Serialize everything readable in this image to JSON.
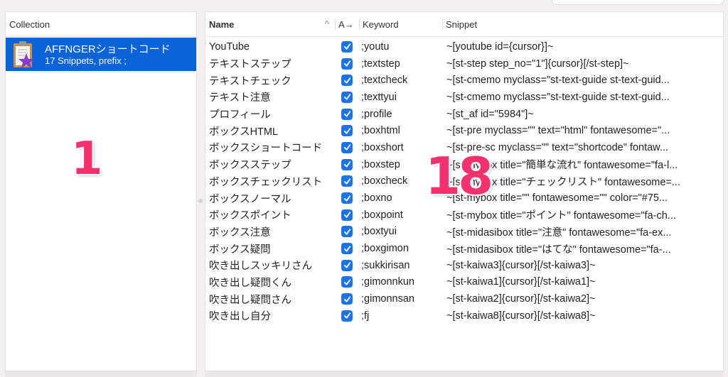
{
  "collection_pane": {
    "header": "Collection",
    "selected_item": {
      "title": "AFFNGERショートコード",
      "subtitle": "17 Snippets, prefix ;",
      "icon": "clipboard-star-icon"
    }
  },
  "snippets_pane": {
    "columns": {
      "name": "Name",
      "sort_indicator": "^",
      "auto_expand": "A→",
      "keyword": "Keyword",
      "snippet": "Snippet"
    },
    "rows": [
      {
        "name": "YouTube",
        "enabled": true,
        "keyword": ";youtu",
        "snippet": "~[youtube id={cursor}]~"
      },
      {
        "name": "テキストステップ",
        "enabled": true,
        "keyword": ";textstep",
        "snippet": "~[st-step step_no=\"1\"]{cursor}[/st-step]~"
      },
      {
        "name": "テキストチェック",
        "enabled": true,
        "keyword": ";textcheck",
        "snippet": "~[st-cmemo myclass=\"st-text-guide st-text-guid..."
      },
      {
        "name": "テキスト注意",
        "enabled": true,
        "keyword": ";texttyui",
        "snippet": "~[st-cmemo myclass=\"st-text-guide st-text-guid..."
      },
      {
        "name": "プロフィール",
        "enabled": true,
        "keyword": ";profile",
        "snippet": "~[st_af id=\"5984\"]~"
      },
      {
        "name": "ボックスHTML",
        "enabled": true,
        "keyword": ";boxhtml",
        "snippet": "~[st-pre myclass=\"\" text=\"html\" fontawesome=\"..."
      },
      {
        "name": "ボックスショートコード",
        "enabled": true,
        "keyword": ";boxshort",
        "snippet": "~[st-pre-sc myclass=\"\" text=\"shortcode\" fontaw..."
      },
      {
        "name": "ボックスステップ",
        "enabled": true,
        "keyword": ";boxstep",
        "snippet": "~[st-mybox title=\"簡単な流れ\" fontawesome=\"fa-l..."
      },
      {
        "name": "ボックスチェックリスト",
        "enabled": true,
        "keyword": ";boxcheck",
        "snippet": "~[st-mybox title=\"チェックリスト\" fontawesome=..."
      },
      {
        "name": "ボックスノーマル",
        "enabled": true,
        "keyword": ";boxno",
        "snippet": "~[st-mybox title=\"\" fontawesome=\"\" color=\"#75..."
      },
      {
        "name": "ボックスポイント",
        "enabled": true,
        "keyword": ";boxpoint",
        "snippet": "~[st-mybox title=\"ポイント\" fontawesome=\"fa-ch..."
      },
      {
        "name": "ボックス注意",
        "enabled": true,
        "keyword": ";boxtyui",
        "snippet": "~[st-midasibox title=\"注意\" fontawesome=\"fa-ex..."
      },
      {
        "name": "ボックス疑問",
        "enabled": true,
        "keyword": ";boxgimon",
        "snippet": "~[st-midasibox title=\"はてな\" fontawesome=\"fa-..."
      },
      {
        "name": "吹き出しスッキリさん",
        "enabled": true,
        "keyword": ";sukkirisan",
        "snippet": "~[st-kaiwa3]{cursor}[/st-kaiwa3]~"
      },
      {
        "name": "吹き出し疑問くん",
        "enabled": true,
        "keyword": ";gimonnkun",
        "snippet": "~[st-kaiwa1]{cursor}[/st-kaiwa1]~"
      },
      {
        "name": "吹き出し疑問さん",
        "enabled": true,
        "keyword": ";gimonnsan",
        "snippet": "~[st-kaiwa2]{cursor}[/st-kaiwa2]~"
      },
      {
        "name": "吹き出し自分",
        "enabled": true,
        "keyword": ";fj",
        "snippet": "~[st-kaiwa8]{cursor}[/st-kaiwa8]~"
      }
    ]
  },
  "annotations": {
    "left_number": "1",
    "right_number": "18"
  },
  "colors": {
    "selection": "#0a63d8",
    "checkbox": "#1a73e8",
    "annotation": "#f4306d"
  }
}
